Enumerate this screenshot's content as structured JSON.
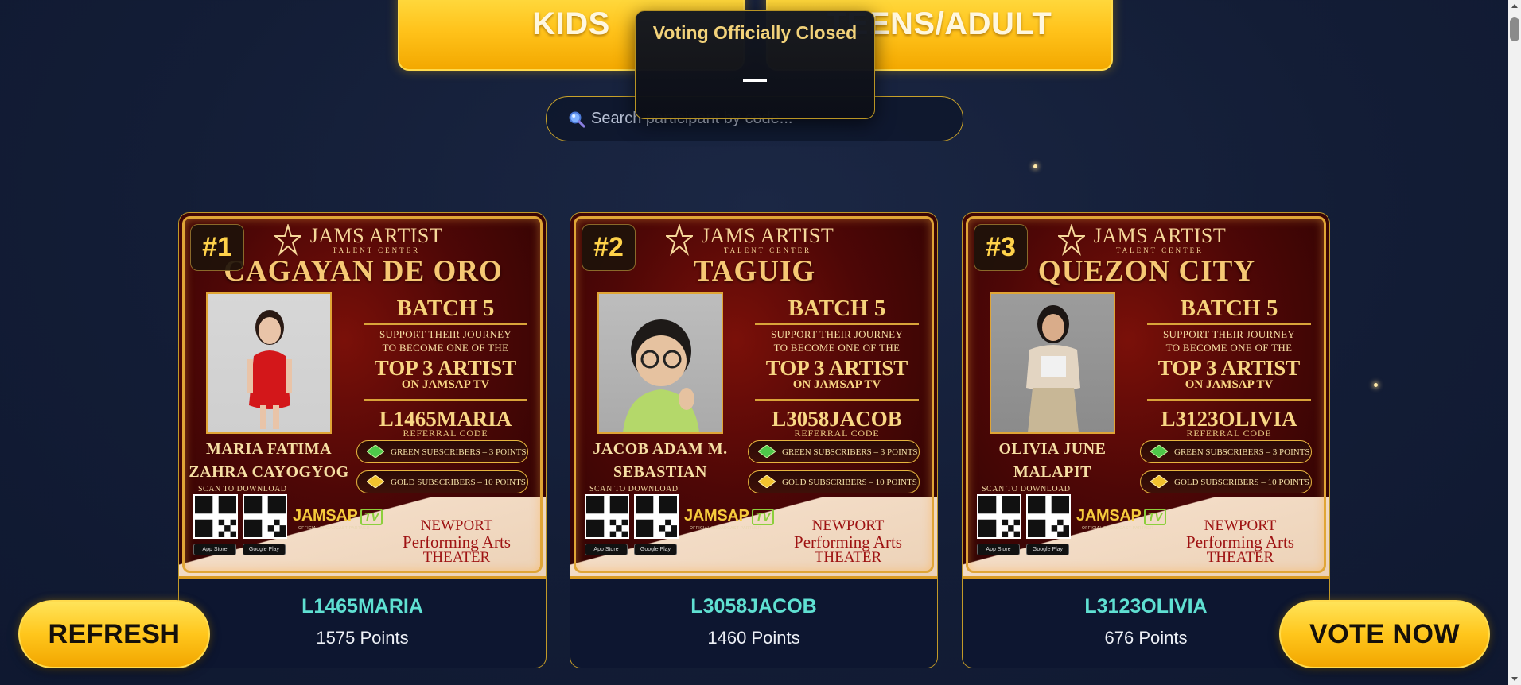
{
  "categories": {
    "kids_label": "KIDS",
    "teens_label": "TEENS/ADULT"
  },
  "voting_status": {
    "title": "Voting Officially Closed",
    "countdown": "—"
  },
  "search": {
    "placeholder": "Search participant by code...",
    "icon": "magnifier-icon"
  },
  "participants": [
    {
      "rank": "#1",
      "brand": "JAMS ARTIST",
      "brand_sub": "TALENT CENTER",
      "city": "CAGAYAN DE ORO",
      "name_line1": "MARIA FATIMA",
      "name_line2": "ZAHRA CAYOGYOG",
      "batch": "BATCH 5",
      "support_line1": "SUPPORT THEIR JOURNEY",
      "support_line2": "TO BECOME ONE OF THE",
      "top3": "TOP 3 ARTIST",
      "on_jamsap": "ON JAMSAP TV",
      "referral_code": "L1465MARIA",
      "referral_label": "REFERRAL CODE",
      "green_subs": "GREEN SUBSCRIBERS – 3 POINTS",
      "gold_subs": "GOLD SUBSCRIBERS – 10 POINTS",
      "scan_text": "SCAN TO DOWNLOAD",
      "app_store": "App Store",
      "google_play": "Google Play",
      "jamsap": "JAMSAP",
      "tv": "TV",
      "broadcast": "OFFICIAL BROADCAST PARTNER",
      "venue_line1": "NEWPORT",
      "venue_line2": "Performing Arts",
      "venue_line3": "THEATER",
      "code": "L1465MARIA",
      "points": "1575 Points"
    },
    {
      "rank": "#2",
      "brand": "JAMS ARTIST",
      "brand_sub": "TALENT CENTER",
      "city": "TAGUIG",
      "name_line1": "JACOB ADAM M.",
      "name_line2": "SEBASTIAN",
      "batch": "BATCH 5",
      "support_line1": "SUPPORT THEIR JOURNEY",
      "support_line2": "TO BECOME ONE OF THE",
      "top3": "TOP 3 ARTIST",
      "on_jamsap": "ON JAMSAP TV",
      "referral_code": "L3058JACOB",
      "referral_label": "REFERRAL CODE",
      "green_subs": "GREEN SUBSCRIBERS – 3 POINTS",
      "gold_subs": "GOLD SUBSCRIBERS – 10 POINTS",
      "scan_text": "SCAN TO DOWNLOAD",
      "app_store": "App Store",
      "google_play": "Google Play",
      "jamsap": "JAMSAP",
      "tv": "TV",
      "broadcast": "OFFICIAL BROADCAST PARTNER",
      "venue_line1": "NEWPORT",
      "venue_line2": "Performing Arts",
      "venue_line3": "THEATER",
      "code": "L3058JACOB",
      "points": "1460 Points"
    },
    {
      "rank": "#3",
      "brand": "JAMS ARTIST",
      "brand_sub": "TALENT CENTER",
      "city": "QUEZON CITY",
      "name_line1": "OLIVIA JUNE",
      "name_line2": "MALAPIT",
      "batch": "BATCH 5",
      "support_line1": "SUPPORT THEIR JOURNEY",
      "support_line2": "TO BECOME ONE OF THE",
      "top3": "TOP 3 ARTIST",
      "on_jamsap": "ON JAMSAP TV",
      "referral_code": "L3123OLIVIA",
      "referral_label": "REFERRAL CODE",
      "green_subs": "GREEN SUBSCRIBERS – 3 POINTS",
      "gold_subs": "GOLD SUBSCRIBERS – 10 POINTS",
      "scan_text": "SCAN TO DOWNLOAD",
      "app_store": "App Store",
      "google_play": "Google Play",
      "jamsap": "JAMSAP",
      "tv": "TV",
      "broadcast": "OFFICIAL BROADCAST PARTNER",
      "venue_line1": "NEWPORT",
      "venue_line2": "Performing Arts",
      "venue_line3": "THEATER",
      "code": "L3123OLIVIA",
      "points": "676 Points"
    }
  ],
  "actions": {
    "refresh_label": "REFRESH",
    "vote_label": "VOTE NOW"
  },
  "colors": {
    "background": "#131d36",
    "accent_gold": "#ffc61c",
    "code_teal": "#5fe0d2",
    "poster_red": "#4e0706"
  }
}
